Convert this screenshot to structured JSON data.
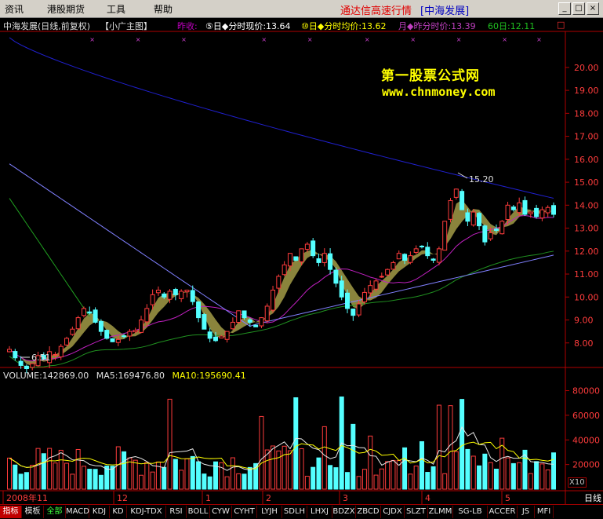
{
  "menu": {
    "items": [
      "资讯",
      "港股期货",
      "工具",
      "帮助"
    ],
    "title": "通达信高速行情",
    "stock_bracket": "[中海发展]",
    "win_buttons": [
      "_",
      "□",
      "×"
    ]
  },
  "header": {
    "stock": "中海发展(日线,前复权)",
    "template": "【小广主图】",
    "yesterday": "昨收:",
    "ind1": "⑤日◆分时现价:13.64",
    "ind2": "⑩日◆分时均价:13.62",
    "ind3": "月◆昨分时价:13.39",
    "ind4": "60日:12.11",
    "end_box": "□"
  },
  "watermark": {
    "line1": "第一股票公式网",
    "line2": "www.chnmoney.com"
  },
  "price_axis": {
    "ticks": [
      "20.00",
      "19.00",
      "18.00",
      "17.00",
      "16.00",
      "15.00",
      "14.00",
      "13.00",
      "12.00",
      "11.00",
      "10.00",
      "9.00",
      "8.00"
    ],
    "min": 7.0,
    "max": 21.5
  },
  "annotations": {
    "high": "15.20",
    "low": "6.51"
  },
  "volume": {
    "label": "VOLUME:142869.00",
    "ma5": "MA5:169476.80",
    "ma10": "MA10:195690.41",
    "ticks": [
      "80000",
      "60000",
      "40000",
      "20000"
    ],
    "unit": "X10",
    "max": 95000
  },
  "time_axis": {
    "labels": [
      "2008年11",
      "12",
      "1",
      "2",
      "3",
      "4",
      "5"
    ]
  },
  "day_button": "日线",
  "tabs": [
    "指标",
    "模板",
    "全部",
    "MACD",
    "KDJ",
    "KD",
    "KDJ-TDX",
    "RSI",
    "BOLL",
    "CYW",
    "CYHT",
    "LYJH",
    "SDLH",
    "LHXJ",
    "BDZX",
    "ZBCD",
    "CJDX",
    "SLZT",
    "ZLMM",
    "SG-LB",
    "ACCER",
    "JS",
    "MFI"
  ],
  "colors": {
    "up": "#ff3c3c",
    "down": "#54ffff",
    "axis": "#b00000",
    "ma_long": "#2020d0",
    "ma_mid": "#8080ff",
    "ma_green": "#209020",
    "ma_purple": "#c020c0"
  },
  "chart_data": {
    "type": "candlestick",
    "series": [
      {
        "name": "close",
        "values": [
          7.72,
          7.35,
          7.02,
          6.88,
          7.1,
          7.45,
          7.3,
          7.62,
          7.5,
          7.85,
          8.2,
          8.6,
          9.1,
          9.5,
          9.3,
          8.9,
          8.5,
          8.2,
          8.05,
          8.15,
          8.3,
          8.5,
          8.55,
          9.0,
          9.5,
          10.1,
          10.3,
          10.0,
          10.25,
          10.1,
          10.25,
          10.3,
          9.8,
          9.1,
          8.6,
          8.2,
          8.1,
          8.3,
          8.5,
          8.9,
          9.4,
          9.1,
          8.9,
          8.7,
          9.1,
          9.6,
          10.3,
          10.9,
          11.4,
          11.9,
          11.6,
          12.1,
          12.3,
          11.8,
          11.5,
          11.9,
          11.2,
          10.6,
          10.0,
          9.5,
          9.2,
          9.7,
          10.2,
          10.5,
          10.7,
          10.9,
          11.2,
          11.5,
          11.9,
          11.6,
          11.8,
          12.1,
          12.2,
          11.8,
          11.6,
          12.1,
          13.3,
          14.2,
          14.7,
          13.8,
          13.3,
          13.7,
          13.1,
          12.4,
          12.8,
          12.9,
          13.3,
          14.0,
          13.8,
          14.1,
          13.6,
          13.7,
          13.5,
          13.8,
          13.9,
          13.6
        ]
      }
    ],
    "annotations": [
      "15.20",
      "6.51"
    ]
  }
}
